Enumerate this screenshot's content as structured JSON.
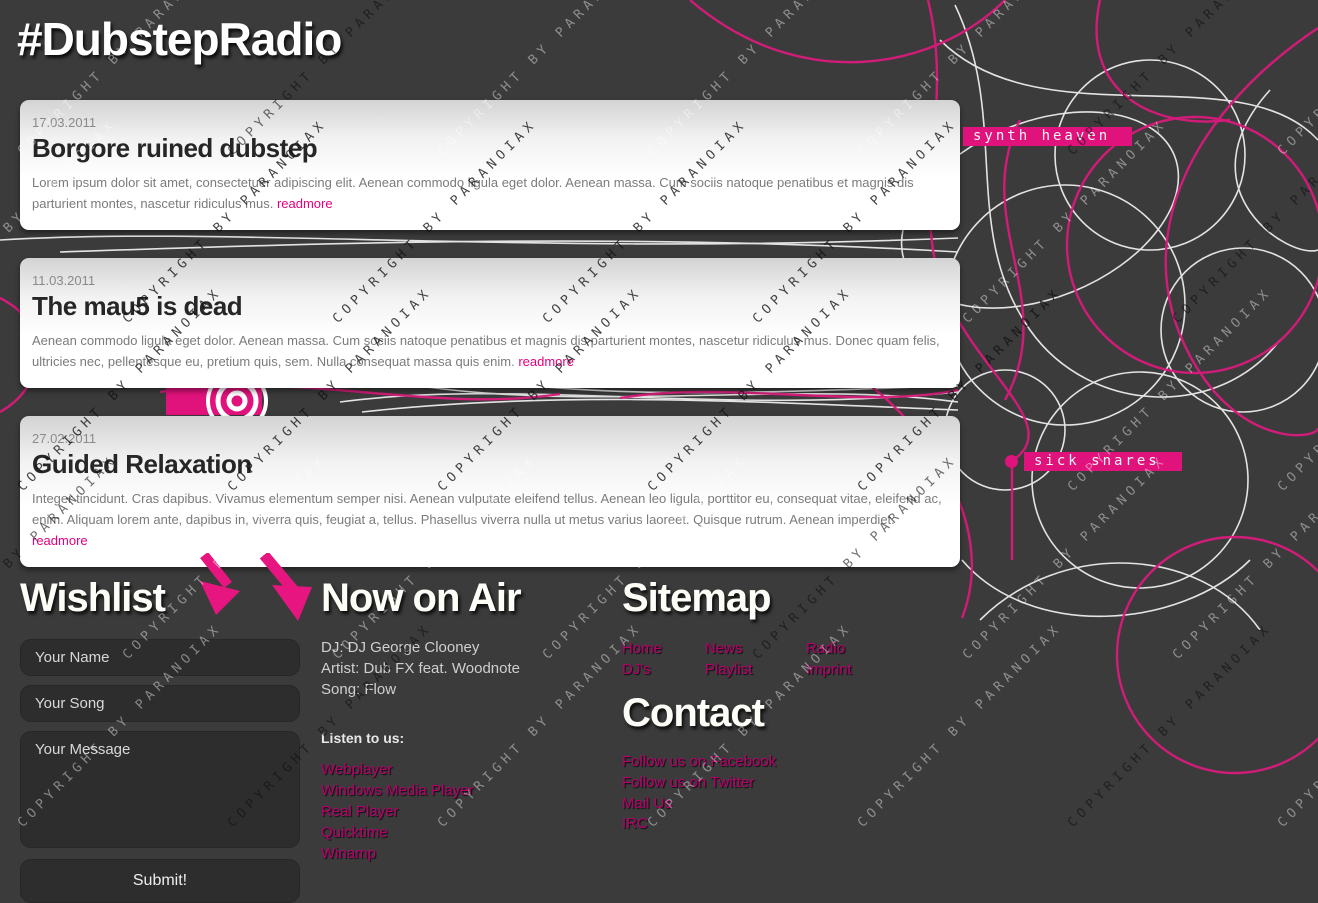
{
  "page": {
    "title": "#DubstepRadio",
    "watermark": "COPYRIGHT BY PARANOIAX"
  },
  "colors": {
    "background": "#3b3b3b",
    "accent_pink": "#e0127c",
    "link_magenta": "#b8006c",
    "readmore_pink": "#e6007e",
    "card_text": "#7b7b7b"
  },
  "news": [
    {
      "date": "17.03.2011",
      "title": "Borgore ruined dubstep",
      "body": "Lorem ipsum dolor sit amet, consectetuer adipiscing elit. Aenean commodo ligula eget dolor. Aenean massa. Cum sociis natoque penatibus et magnis dis parturient montes, nascetur ridiculus mus.",
      "readmore_label": "readmore"
    },
    {
      "date": "11.03.2011",
      "title": "The mau5 is dead",
      "body": "Aenean commodo ligula eget dolor. Aenean massa. Cum sociis natoque penatibus et magnis dis parturient montes, nascetur ridiculus mus. Donec quam felis, ultricies nec, pellentesque eu, pretium quis, sem. Nulla consequat massa quis enim.",
      "readmore_label": "readmore"
    },
    {
      "date": "27.02.2011",
      "title": "Guided Relaxation",
      "body": "Integer tincidunt. Cras dapibus. Vivamus elementum semper nisi. Aenean vulputate eleifend tellus. Aenean leo ligula, porttitor eu, consequat vitae, eleifend ac, enim. Aliquam lorem ante, dapibus in, viverra quis, feugiat a, tellus. Phasellus viverra nulla ut metus varius laoreet. Quisque rutrum. Aenean imperdiet.",
      "readmore_label": "readmore"
    }
  ],
  "side_tags": [
    "synth heaven",
    "sick snares"
  ],
  "wishlist": {
    "heading": "Wishlist",
    "name_placeholder": "Your Name",
    "song_placeholder": "Your Song",
    "message_placeholder": "Your Message",
    "submit_label": "Submit!"
  },
  "now_on_air": {
    "heading": "Now on Air",
    "dj_line": "DJ: DJ George Clooney",
    "artist_line": "Artist: Dub FX feat. Woodnote",
    "song_line": "Song: Flow",
    "listen_heading": "Listen to us:",
    "players": [
      "Webplayer",
      "Windows Media Player",
      "Real Player",
      "Quicktime",
      "Winamp"
    ]
  },
  "sitemap": {
    "heading": "Sitemap",
    "links": [
      "Home",
      "News",
      "Radio",
      "DJ's",
      "Playlist",
      "Imprint"
    ]
  },
  "contact": {
    "heading": "Contact",
    "links": [
      "Follow us on Facebook",
      "Follow us on Twitter",
      "Mail Us",
      "IRC"
    ]
  }
}
